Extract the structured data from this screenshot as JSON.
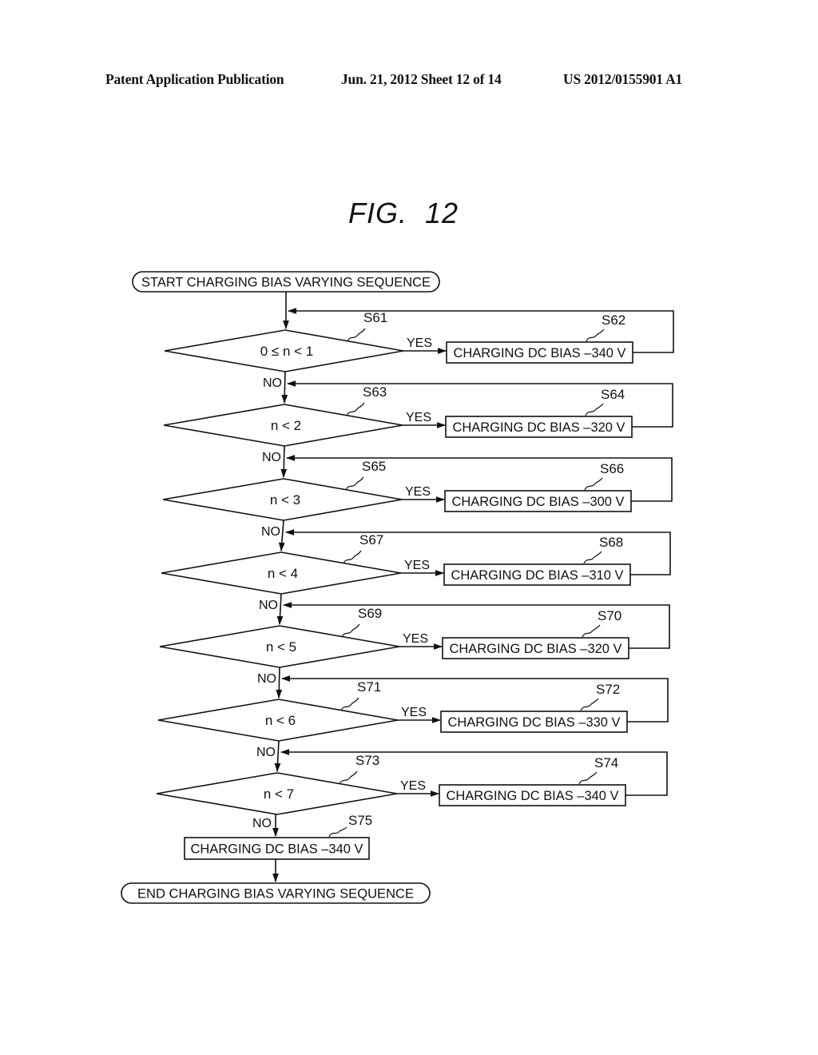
{
  "header": {
    "publication_type": "Patent Application Publication",
    "date_sheet": "Jun. 21, 2012  Sheet 12 of 14",
    "patent_number": "US 2012/0155901 A1"
  },
  "figure": {
    "title": "FIG.  12"
  },
  "flowchart": {
    "start_label": "START CHARGING BIAS VARYING SEQUENCE",
    "end_label": "END CHARGING BIAS VARYING SEQUENCE",
    "yes_label": "YES",
    "no_label": "NO",
    "decisions": [
      {
        "step": "S61",
        "condition": "0 ≤ n < 1",
        "action_step": "S62",
        "action": "CHARGING DC BIAS –340 V"
      },
      {
        "step": "S63",
        "condition": "n < 2",
        "action_step": "S64",
        "action": "CHARGING DC BIAS –320 V"
      },
      {
        "step": "S65",
        "condition": "n < 3",
        "action_step": "S66",
        "action": "CHARGING DC BIAS –300 V"
      },
      {
        "step": "S67",
        "condition": "n < 4",
        "action_step": "S68",
        "action": "CHARGING DC BIAS –310 V"
      },
      {
        "step": "S69",
        "condition": "n < 5",
        "action_step": "S70",
        "action": "CHARGING DC BIAS –320 V"
      },
      {
        "step": "S71",
        "condition": "n < 6",
        "action_step": "S72",
        "action": "CHARGING DC BIAS –330 V"
      },
      {
        "step": "S73",
        "condition": "n < 7",
        "action_step": "S74",
        "action": "CHARGING DC BIAS –340 V"
      }
    ],
    "final_action": {
      "step": "S75",
      "action": "CHARGING DC BIAS –340 V"
    }
  }
}
